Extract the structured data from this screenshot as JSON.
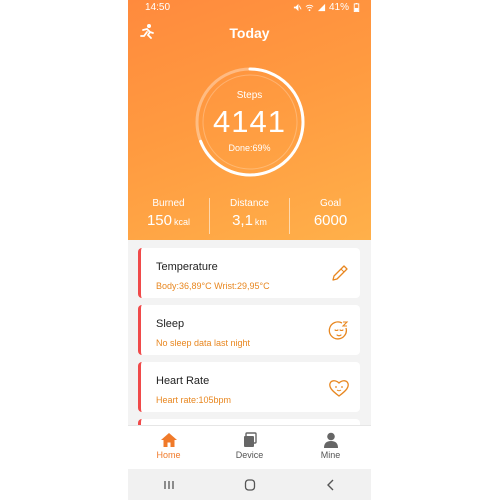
{
  "status": {
    "time": "14:50",
    "battery": "41%"
  },
  "header": {
    "title": "Today"
  },
  "steps": {
    "label": "Steps",
    "value": "4141",
    "done": "Done:69%",
    "progress": 0.69
  },
  "stats": [
    {
      "label": "Burned",
      "value": "150",
      "unit": "kcal"
    },
    {
      "label": "Distance",
      "value": "3,1",
      "unit": "km"
    },
    {
      "label": "Goal",
      "value": "6000",
      "unit": ""
    }
  ],
  "cards": {
    "temperature": {
      "title": "Temperature",
      "sub": "Body:36,89°C  Wrist:29,95°C"
    },
    "sleep": {
      "title": "Sleep",
      "sub": "No sleep data last night"
    },
    "heart": {
      "title": "Heart Rate",
      "sub": "Heart rate:105bpm"
    }
  },
  "nav": {
    "home": "Home",
    "device": "Device",
    "mine": "Mine"
  },
  "colors": {
    "accent": "#ff8a3d",
    "card_text": "#e88720",
    "card_stripe": "#f04a4a",
    "nav_active": "#f07a2a",
    "nav_inactive": "#555555"
  }
}
